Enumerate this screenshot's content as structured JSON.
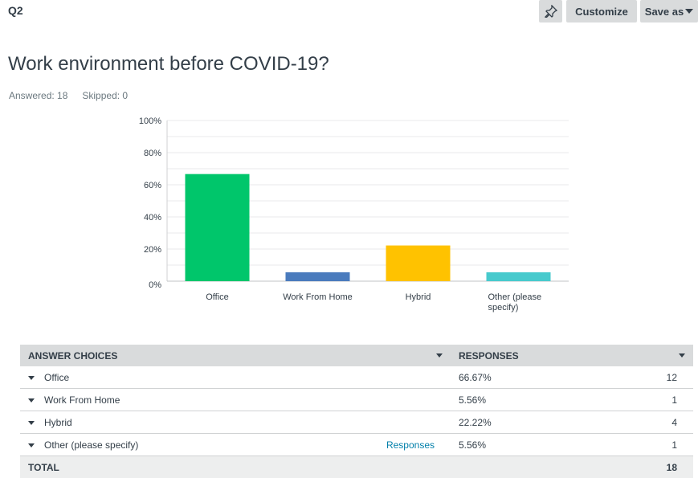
{
  "header": {
    "question_number": "Q2",
    "customize_label": "Customize",
    "save_as_label": "Save as",
    "pin_icon": "pin-icon"
  },
  "question": {
    "title": "Work environment before COVID-19?",
    "answered": "Answered: 18",
    "skipped": "Skipped: 0"
  },
  "chart_data": {
    "type": "bar",
    "categories": [
      "Office",
      "Work From Home",
      "Hybrid",
      "Other (please specify)"
    ],
    "category_lines": [
      [
        "Office"
      ],
      [
        "Work From Home"
      ],
      [
        "Hybrid"
      ],
      [
        "Other (please",
        "specify)"
      ]
    ],
    "values": [
      66.67,
      5.56,
      22.22,
      5.56
    ],
    "colors": [
      "#00c66b",
      "#4a7bbd",
      "#ffc200",
      "#47cacd"
    ],
    "ylim": [
      0,
      100
    ],
    "yticks": [
      "0%",
      "20%",
      "40%",
      "60%",
      "80%",
      "100%"
    ],
    "grid": true
  },
  "table": {
    "headers": {
      "choices": "ANSWER CHOICES",
      "responses": "RESPONSES"
    },
    "rows": [
      {
        "choice": "Office",
        "link": "",
        "percent": "66.67%",
        "count": "12"
      },
      {
        "choice": "Work From Home",
        "link": "",
        "percent": "5.56%",
        "count": "1"
      },
      {
        "choice": "Hybrid",
        "link": "",
        "percent": "22.22%",
        "count": "4"
      },
      {
        "choice": "Other (please specify)",
        "link": "Responses",
        "percent": "5.56%",
        "count": "1"
      }
    ],
    "total_label": "TOTAL",
    "total_count": "18"
  }
}
